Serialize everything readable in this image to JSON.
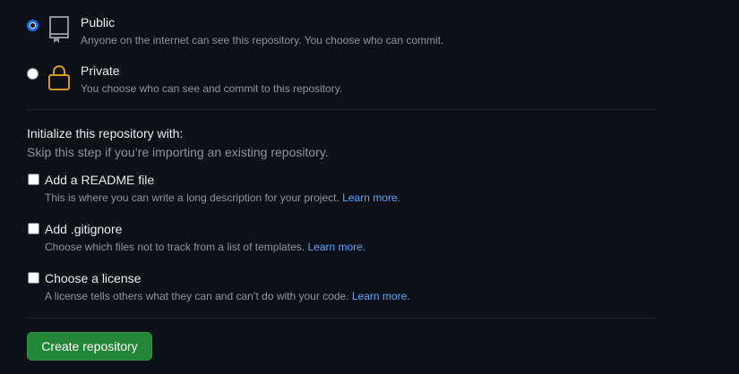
{
  "visibility": {
    "public": {
      "title": "Public",
      "description": "Anyone on the internet can see this repository. You choose who can commit.",
      "selected": true,
      "icon": "repo-icon"
    },
    "private": {
      "title": "Private",
      "description": "You choose who can see and commit to this repository.",
      "selected": false,
      "icon": "lock-icon"
    }
  },
  "initialize": {
    "title": "Initialize this repository with:",
    "subtitle": "Skip this step if you’re importing an existing repository.",
    "readme": {
      "title": "Add a README file",
      "description": "This is where you can write a long description for your project.",
      "link": "Learn more."
    },
    "gitignore": {
      "title": "Add .gitignore",
      "description": "Choose which files not to track from a list of templates.",
      "link": "Learn more."
    },
    "license": {
      "title": "Choose a license",
      "description": "A license tells others what they can and can’t do with your code.",
      "link": "Learn more."
    }
  },
  "actions": {
    "create_label": "Create repository"
  },
  "colors": {
    "background": "#0d1117",
    "primary_button": "#238636",
    "link": "#58a6ff",
    "radio_selected": "#1f6feb",
    "lock_icon": "#d29922"
  }
}
